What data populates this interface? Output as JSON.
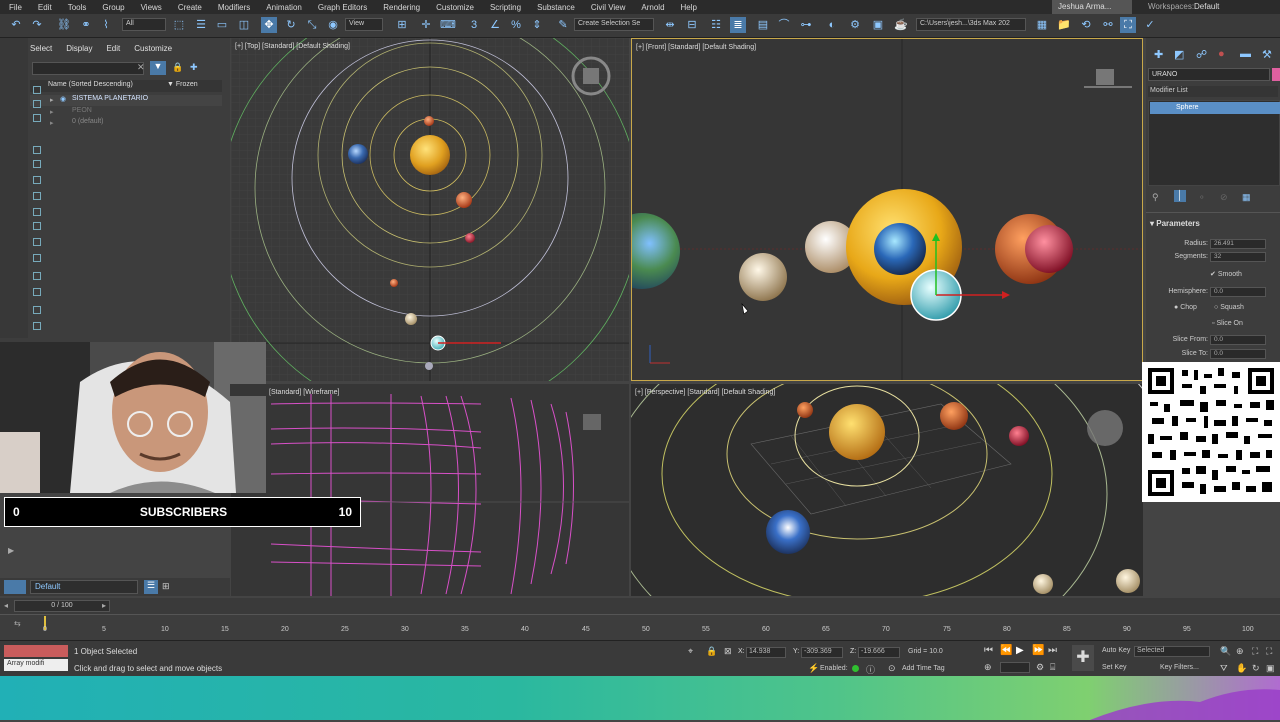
{
  "menu": [
    "File",
    "Edit",
    "Tools",
    "Group",
    "Views",
    "Create",
    "Modifiers",
    "Animation",
    "Graph Editors",
    "Rendering",
    "Customize",
    "Scripting",
    "Substance",
    "Civil View",
    "Arnold",
    "Help"
  ],
  "user": "Jeshua Arma...",
  "workspaces_label": "Workspaces:",
  "workspace_value": "Default",
  "toolbar": {
    "selection_filter": "All",
    "view_dropdown": "View",
    "selection_set": "Create Selection Se",
    "path": "C:\\Users\\jesh...\\3ds Max 202"
  },
  "explorer": {
    "tabs": [
      "Select",
      "Display",
      "Edit",
      "Customize"
    ],
    "column_name": "Name (Sorted Descending)",
    "column_frozen": "Frozen",
    "rows": [
      "SISTEMA PLANETARIO",
      "PEON",
      "0 (default)"
    ]
  },
  "viewports": {
    "top": "[+] [Top] [Standard] [Default Shading]",
    "front": "[+] [Front] [Standard] [Default Shading]",
    "left": "[Standard] [Wireframe]",
    "perspective": "[+] [Perspective] [Standard] [Default Shading]"
  },
  "command_panel": {
    "object_name": "URANO",
    "modifier_list": "Modifier List",
    "stack_item": "Sphere",
    "rollout": "Parameters",
    "params": [
      {
        "label": "Radius:",
        "value": "26.491"
      },
      {
        "label": "Segments:",
        "value": "32"
      },
      {
        "label": "Hemisphere:",
        "value": "0.0"
      },
      {
        "label": "Slice From:",
        "value": "0.0"
      },
      {
        "label": "Slice To:",
        "value": "0.0"
      }
    ],
    "smooth": "Smooth",
    "chop": "Chop",
    "squash": "Squash",
    "slice_on": "Slice On"
  },
  "overlay": {
    "subs_left": "0",
    "subs_label": "SUBSCRIBERS",
    "subs_right": "10"
  },
  "layer": "Default",
  "timeline": {
    "slider": "0 / 100",
    "ticks": [
      "0",
      "5",
      "10",
      "15",
      "20",
      "25",
      "30",
      "35",
      "40",
      "45",
      "50",
      "55",
      "60",
      "65",
      "70",
      "75",
      "80",
      "85",
      "90",
      "95",
      "100"
    ]
  },
  "status": {
    "mini_listener": "Array modifi",
    "selected": "1 Object Selected",
    "prompt": "Click and drag to select and move objects",
    "x_label": "X:",
    "x": "14.938",
    "y_label": "Y:",
    "y": "-309.369",
    "z_label": "Z:",
    "z": "-19.666",
    "grid": "Grid = 10.0",
    "enabled": "Enabled:",
    "add_time_tag": "Add Time Tag",
    "auto_key": "Auto Key",
    "set_key": "Set Key",
    "selected_dd": "Selected",
    "key_filters": "Key Filters..."
  },
  "colors": {
    "accent": "#5a8fc6",
    "frame_active": "#c8a84a",
    "menu_bg": "#2b2b2b",
    "panel_bg": "#3d3d3d"
  }
}
